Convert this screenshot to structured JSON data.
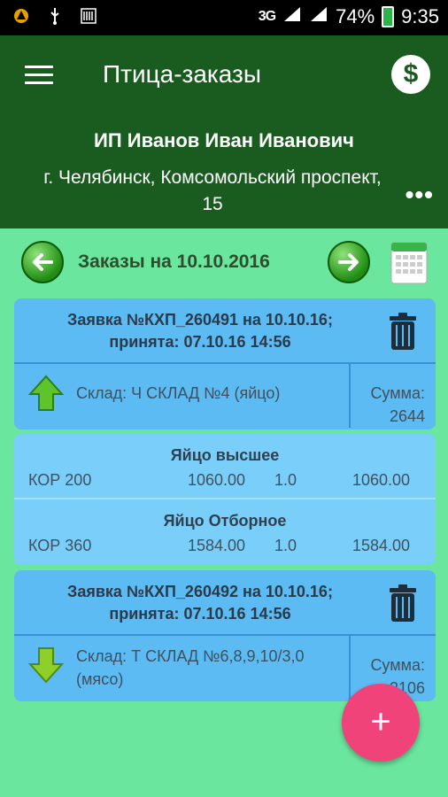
{
  "statusbar": {
    "network": "3G",
    "battery": "74%",
    "time": "9:35"
  },
  "appbar": {
    "title": "Птица-заказы",
    "client_name": "ИП Иванов Иван Иванович",
    "client_address": "г. Челябинск, Комсомольский проспект, 15",
    "more_label": "•••",
    "dollar_label": "$"
  },
  "datebar": {
    "label": "Заказы на 10.10.2016"
  },
  "orders": [
    {
      "title_line1": "Заявка №КХП_260491 на 10.10.16;",
      "title_line2": "принята: 07.10.16 14:56",
      "store": "Склад: Ч СКЛАД №4 (яйцо)",
      "sum_label": "Сумма:",
      "sum_value": "2644",
      "direction": "up"
    },
    {
      "title_line1": "Заявка №КХП_260492 на 10.10.16;",
      "title_line2": "принята: 07.10.16 14:56",
      "store": "Склад: Т СКЛАД №6,8,9,10/3,0 (мясо)",
      "sum_label": "Сумма:",
      "sum_value": "2106",
      "direction": "down"
    }
  ],
  "items": [
    {
      "name": "Яйцо высшее",
      "code": "КОР 200",
      "price": "1060.00",
      "qty": "1.0",
      "total": "1060.00"
    },
    {
      "name": "Яйцо Отборное",
      "code": "КОР 360",
      "price": "1584.00",
      "qty": "1.0",
      "total": "1584.00"
    }
  ],
  "fab_label": "+",
  "colors": {
    "background": "#6be69e",
    "appbar": "#1a5c20",
    "card": "#5bbbf2",
    "items": "#79cffa",
    "fab": "#f0437a"
  }
}
